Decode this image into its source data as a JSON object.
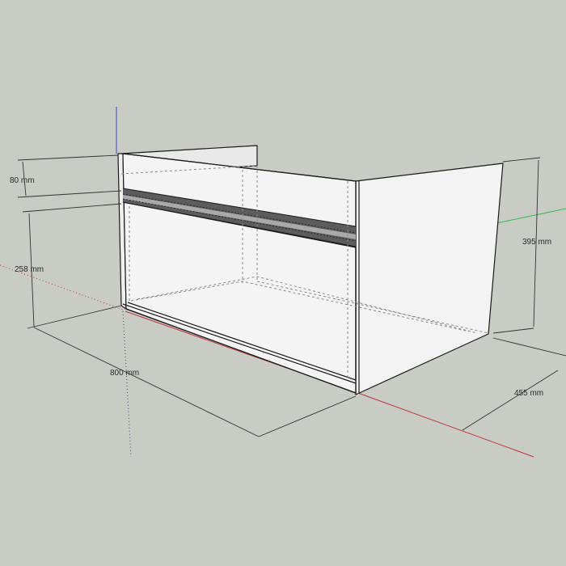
{
  "dimensions": {
    "rail_height": "80 mm",
    "drawer_height": "258 mm",
    "width": "800 mm",
    "height": "395 mm",
    "depth": "455 mm"
  },
  "colors": {
    "background": "#c9cbc5",
    "panel_fill": "#f3f3f3",
    "edge": "#1a1a1a",
    "hidden_edge": "#8a8a8a",
    "dimension_line": "#333333",
    "axis_red": "#c0353b",
    "axis_green": "#39b54a",
    "axis_blue": "#3a44c8"
  }
}
